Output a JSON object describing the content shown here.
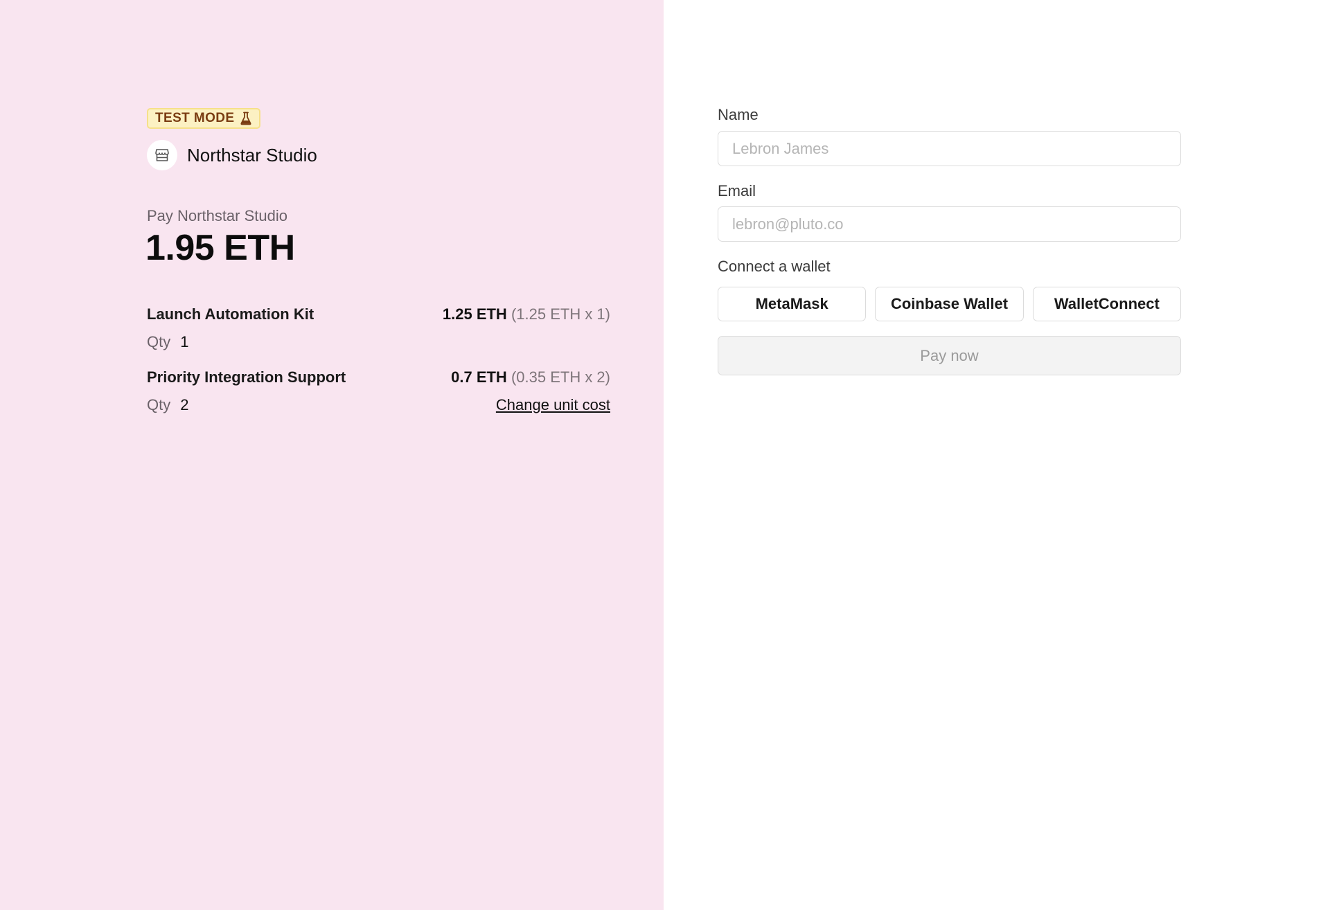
{
  "colors": {
    "left_background": "#f9e5f0",
    "right_background": "#ffffff",
    "badge_background": "#fcf1c3",
    "badge_text": "#7a3c12"
  },
  "summary": {
    "badge": {
      "label": "TEST MODE",
      "icon": "flask-icon"
    },
    "store": {
      "icon": "store-icon",
      "name": "Northstar Studio"
    },
    "pay_label": "Pay Northstar Studio",
    "total": "1.95 ETH",
    "items": [
      {
        "name": "Launch Automation Kit",
        "price": "1.25 ETH",
        "breakdown": "(1.25 ETH x 1)",
        "qty_label": "Qty",
        "qty": "1"
      },
      {
        "name": "Priority Integration Support",
        "price": "0.7 ETH",
        "breakdown": "(0.35 ETH x 2)",
        "qty_label": "Qty",
        "qty": "2",
        "link": "Change unit cost"
      }
    ]
  },
  "form": {
    "name_label": "Name",
    "name_placeholder": "Lebron James",
    "email_label": "Email",
    "email_placeholder": "lebron@pluto.co",
    "wallet_label": "Connect a wallet",
    "wallets": [
      "MetaMask",
      "Coinbase Wallet",
      "WalletConnect"
    ],
    "pay_button": "Pay now"
  }
}
